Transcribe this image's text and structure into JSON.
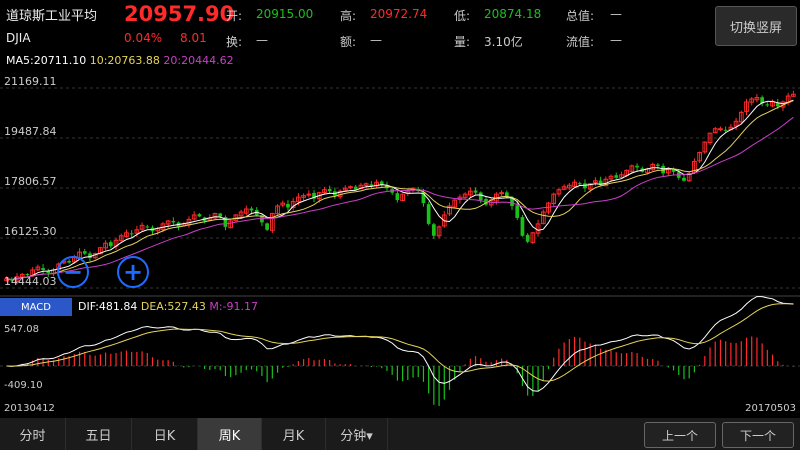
{
  "stock": {
    "name": "道琼斯工业平均",
    "code": "DJIA",
    "price": "20957.90",
    "change_pct": "0.04%",
    "change": "8.01"
  },
  "quote": {
    "open_label": "开:",
    "open": "20915.00",
    "high_label": "高:",
    "high": "20972.74",
    "low_label": "低:",
    "low": "20874.18",
    "total_value_label": "总值:",
    "total_value": "—",
    "turnover_label": "换:",
    "turnover": "—",
    "amount_label": "额:",
    "amount": "—",
    "volume_label": "量:",
    "volume": "3.10亿",
    "float_value_label": "流值:",
    "float_value": "—"
  },
  "switch_button": "切换竖屏",
  "ma": {
    "ma5": "MA5:20711.10",
    "ma10": "10:20763.88",
    "ma20": "20:20444.62"
  },
  "macd": {
    "tab": "MACD",
    "dif": "DIF:481.84",
    "dea": "DEA:527.43",
    "m": "M:-91.17",
    "y_top": "547.08",
    "y_bottom": "-409.10"
  },
  "price_axis": [
    "21169.11",
    "19487.84",
    "17806.57",
    "16125.30",
    "14444.03"
  ],
  "dates": {
    "start": "20130412",
    "end": "20170503"
  },
  "tabs": [
    {
      "label": "分时"
    },
    {
      "label": "五日"
    },
    {
      "label": "日K"
    },
    {
      "label": "周K"
    },
    {
      "label": "月K"
    },
    {
      "label": "分钟▾"
    }
  ],
  "nav": {
    "prev": "上一个",
    "next": "下一个"
  },
  "controls": {
    "zoom_out_icon": "minus-icon",
    "zoom_in_icon": "plus-icon"
  },
  "colors": {
    "up": "#ff2a2a",
    "down": "#19c219",
    "ma5": "#ffffff",
    "ma10": "#e6d35a",
    "ma20": "#c93fc9",
    "accent": "#1e6cff"
  },
  "chart_data": {
    "type": "candlestick",
    "ylim": [
      14444.03,
      21169.11
    ],
    "close": [
      14750,
      14700,
      14820,
      14900,
      14880,
      15050,
      15150,
      15050,
      14950,
      15050,
      15250,
      15350,
      15300,
      15500,
      15650,
      15600,
      15450,
      15600,
      15800,
      15950,
      15850,
      16050,
      16200,
      16300,
      16250,
      16400,
      16550,
      16500,
      16350,
      16450,
      16600,
      16700,
      16650,
      16500,
      16600,
      16750,
      16900,
      16850,
      16700,
      16800,
      16950,
      16850,
      16500,
      16700,
      16900,
      17000,
      17100,
      17050,
      16900,
      16650,
      16400,
      16950,
      17200,
      17300,
      17150,
      17350,
      17500,
      17550,
      17600,
      17450,
      17650,
      17750,
      17700,
      17550,
      17700,
      17800,
      17850,
      17750,
      17900,
      17950,
      17850,
      18000,
      17900,
      17800,
      17650,
      17400,
      17600,
      17700,
      17800,
      17700,
      17300,
      16600,
      16200,
      16500,
      16900,
      17200,
      17400,
      17500,
      17600,
      17700,
      17650,
      17400,
      17250,
      17400,
      17600,
      17650,
      17500,
      17200,
      16800,
      16200,
      16000,
      16300,
      16600,
      17000,
      17300,
      17600,
      17750,
      17850,
      17900,
      18000,
      17950,
      17800,
      17950,
      18050,
      17900,
      18100,
      18200,
      18150,
      18250,
      18400,
      18550,
      18500,
      18350,
      18450,
      18600,
      18550,
      18300,
      18450,
      18350,
      18150,
      18050,
      18300,
      18700,
      19000,
      19350,
      19650,
      19800,
      19800,
      19750,
      19850,
      20050,
      20350,
      20700,
      20800,
      20850,
      20650,
      20600,
      20700,
      20550,
      20700,
      20900,
      20958
    ],
    "ma5_note": "short moving average (white)",
    "ma10_note": "medium moving average (yellow)",
    "ma20_note": "long moving average (magenta)"
  }
}
